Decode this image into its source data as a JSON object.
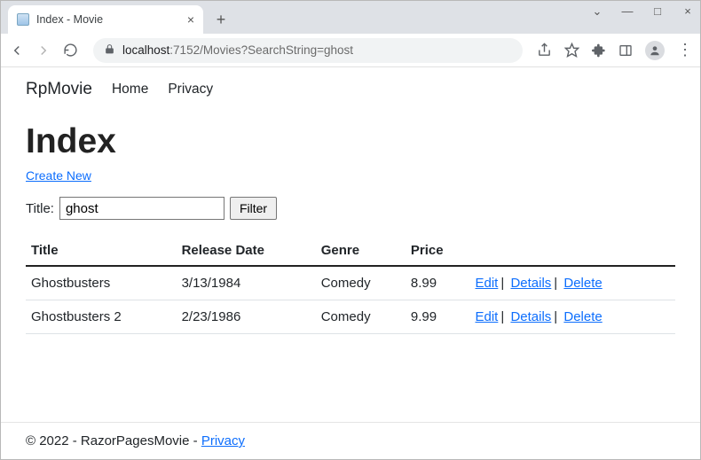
{
  "browser": {
    "tab_title": "Index - Movie",
    "url_host": "localhost",
    "url_port": ":7152",
    "url_path": "/Movies?SearchString=ghost"
  },
  "nav": {
    "brand": "RpMovie",
    "links": [
      "Home",
      "Privacy"
    ]
  },
  "page": {
    "title": "Index",
    "create_link": "Create New",
    "filter": {
      "label": "Title:",
      "value": "ghost",
      "button": "Filter"
    },
    "columns": [
      "Title",
      "Release Date",
      "Genre",
      "Price",
      ""
    ],
    "rows": [
      {
        "title": "Ghostbusters",
        "release": "3/13/1984",
        "genre": "Comedy",
        "price": "8.99"
      },
      {
        "title": "Ghostbusters 2",
        "release": "2/23/1986",
        "genre": "Comedy",
        "price": "9.99"
      }
    ],
    "actions": {
      "edit": "Edit",
      "details": "Details",
      "delete": "Delete"
    }
  },
  "footer": {
    "prefix": "© 2022 - RazorPagesMovie - ",
    "privacy": "Privacy"
  }
}
